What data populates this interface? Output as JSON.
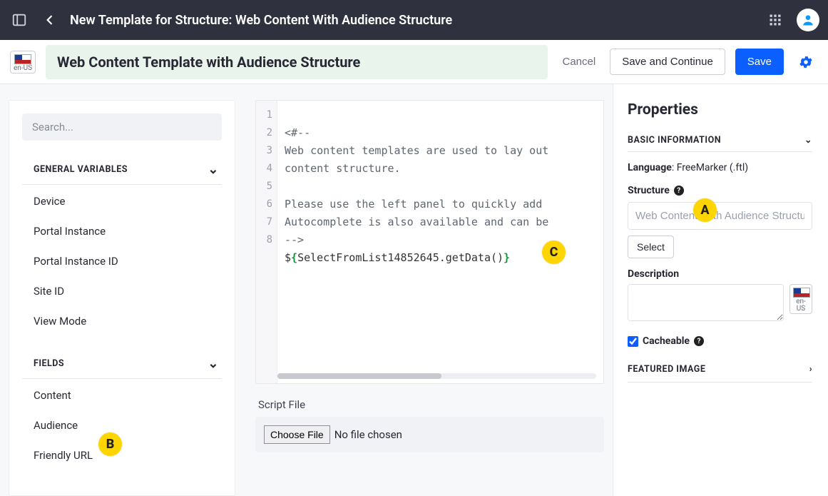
{
  "topbar": {
    "page_title": "New Template for Structure: Web Content With Audience Structure"
  },
  "subbar": {
    "lang_code": "en-US",
    "template_title": "Web Content Template with Audience Structure",
    "cancel": "Cancel",
    "save_continue": "Save and Continue",
    "save": "Save"
  },
  "left": {
    "search_placeholder": "Search...",
    "sections": {
      "general": {
        "title": "GENERAL VARIABLES",
        "items": [
          "Device",
          "Portal Instance",
          "Portal Instance ID",
          "Site ID",
          "View Mode"
        ]
      },
      "fields": {
        "title": "FIELDS",
        "items": [
          "Content",
          "Audience",
          "Friendly URL"
        ]
      }
    }
  },
  "editor": {
    "lines": [
      "1",
      "2",
      "3",
      "4",
      "5",
      "6",
      "7",
      "8"
    ],
    "code_comment_1": "<#--",
    "code_comment_2": "Web content templates are used to lay out",
    "code_comment_3": "content structure.",
    "code_comment_4": "",
    "code_comment_5": "Please use the left panel to quickly add ",
    "code_comment_6": "Autocomplete is also available and can be",
    "code_comment_7": "-->",
    "code_expr_inner": "SelectFromList14852645.getData()",
    "script_label": "Script File",
    "choose_file": "Choose File",
    "no_file": "No file chosen"
  },
  "props": {
    "title": "Properties",
    "basic_info": "BASIC INFORMATION",
    "language_label": "Language",
    "language_value": "FreeMarker (.ftl)",
    "structure_label": "Structure",
    "structure_value": "Web Content With Audience Structure",
    "select_btn": "Select",
    "description_label": "Description",
    "desc_lang": "en-US",
    "cacheable_label": "Cacheable",
    "featured_image": "FEATURED IMAGE"
  },
  "annotations": {
    "a": "A",
    "b": "B",
    "c": "C"
  }
}
